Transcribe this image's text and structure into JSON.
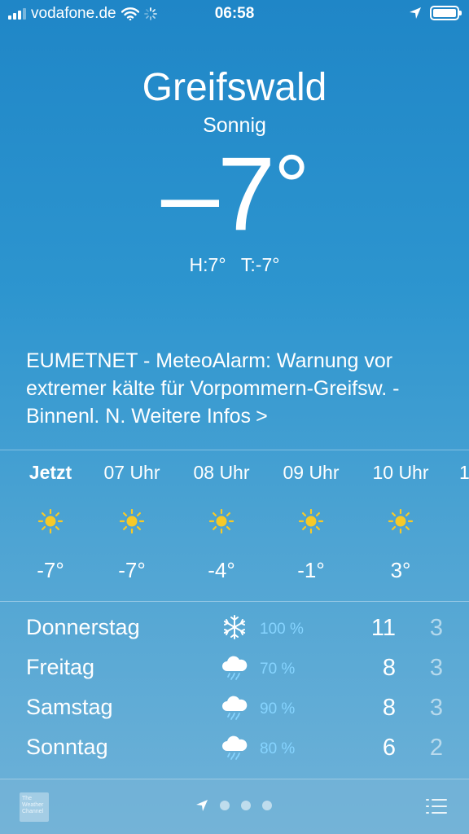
{
  "status_bar": {
    "carrier": "vodafone.de",
    "time": "06:58"
  },
  "weather": {
    "city": "Greifswald",
    "condition": "Sonnig",
    "temp_value": "–7",
    "temp_unit": "°",
    "high": "H:7°",
    "low": "T:-7°"
  },
  "alert": {
    "text": "EUMETNET - MeteoAlarm: Warnung vor extremer kälte für Vorpommern-Greifsw. - Binnenl. N. Weitere Infos",
    "chevron": ">"
  },
  "hourly": [
    {
      "label": "Jetzt",
      "icon": "sun-icon",
      "temp": "-7°"
    },
    {
      "label": "07 Uhr",
      "icon": "sun-icon",
      "temp": "-7°"
    },
    {
      "label": "08 Uhr",
      "icon": "sun-icon",
      "temp": "-4°"
    },
    {
      "label": "09 Uhr",
      "icon": "sun-icon",
      "temp": "-1°"
    },
    {
      "label": "10 Uhr",
      "icon": "sun-icon",
      "temp": "3°"
    },
    {
      "label": "1",
      "icon": "",
      "temp": ""
    }
  ],
  "daily": [
    {
      "day": "Donnerstag",
      "icon": "snowflake-icon",
      "precip": "100 %",
      "high": "11",
      "low": "3"
    },
    {
      "day": "Freitag",
      "icon": "rain-cloud-icon",
      "precip": "70 %",
      "high": "8",
      "low": "3"
    },
    {
      "day": "Samstag",
      "icon": "rain-cloud-icon",
      "precip": "90 %",
      "high": "8",
      "low": "3"
    },
    {
      "day": "Sonntag",
      "icon": "rain-cloud-icon",
      "precip": "80 %",
      "high": "6",
      "low": "2"
    }
  ],
  "bottom_bar": {
    "logo_text": "The Weather Channel"
  },
  "colors": {
    "sun": "#f6c928",
    "precip": "#86d4ff"
  }
}
